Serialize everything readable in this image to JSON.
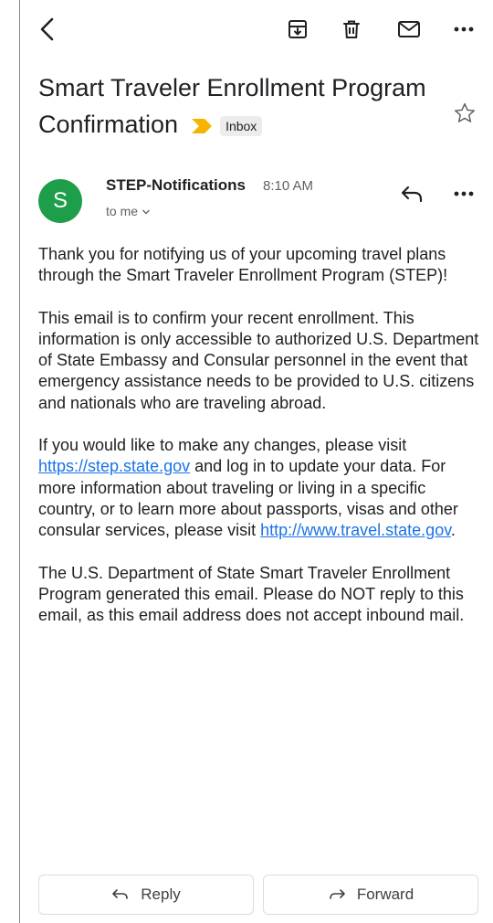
{
  "toolbar": {
    "back_icon": "back-arrow-icon",
    "archive_icon": "archive-icon",
    "delete_icon": "trash-icon",
    "mark_unread_icon": "mail-icon",
    "more_icon": "more-horizontal-icon"
  },
  "email": {
    "subject": "Smart Traveler Enrollment Program Confirmation",
    "label": "Inbox",
    "importance_color": "#f6b400",
    "sender": {
      "initial": "S",
      "name": "STEP-Notifications",
      "time": "8:10 AM",
      "recipient": "to me",
      "avatar_color": "#1e9e4a"
    },
    "body": {
      "p1": "Thank you for notifying us of your upcoming travel plans through the Smart Traveler Enrollment Program (STEP)!",
      "p2": "This email is to confirm your recent enrollment. This information is only accessible to authorized U.S. Department of State Embassy and Consular personnel in the event that emergency assistance needs to be provided to U.S. citizens and nationals who are traveling abroad.",
      "p3_part1": "If you would like to make any changes, please visit ",
      "p3_link1": "https://step.state.gov",
      "p3_part2": " and log in to update your data. For more information about traveling or living in a specific country, or to learn more about passports, visas and other consular services, please visit ",
      "p3_link2": "http://www.travel.state.gov",
      "p3_part3": ".",
      "p4": "The U.S. Department of State Smart Traveler Enrollment Program generated this email. Please do NOT reply to this email, as this email address does not accept inbound mail."
    }
  },
  "actions": {
    "reply_label": "Reply",
    "forward_label": "Forward"
  },
  "colors": {
    "link": "#1a73e8",
    "text": "#202124",
    "secondary": "#5f6368"
  }
}
